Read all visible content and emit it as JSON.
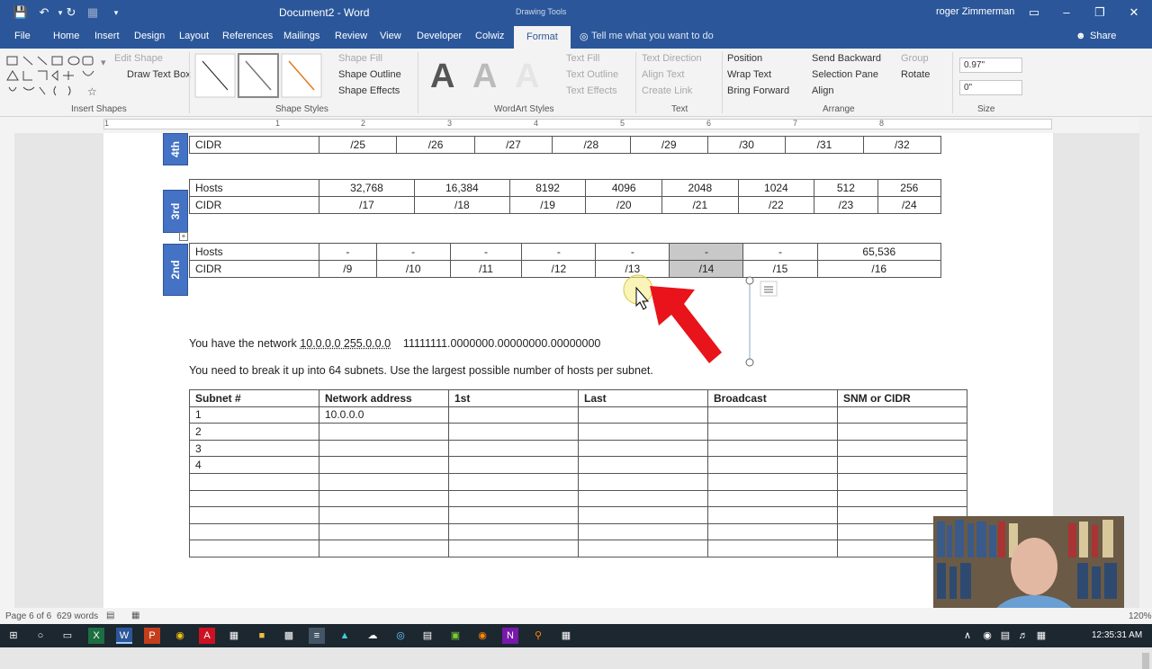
{
  "titlebar": {
    "document_title": "Document2 - Word",
    "context": "Drawing Tools",
    "user": "roger Zimmerman"
  },
  "tabs": {
    "file": "File",
    "home": "Home",
    "insert": "Insert",
    "design": "Design",
    "layout": "Layout",
    "references": "References",
    "mailings": "Mailings",
    "review": "Review",
    "view": "View",
    "developer": "Developer",
    "colwiz": "Colwiz",
    "format": "Format",
    "tell": "Tell me what you want to do",
    "share": "Share"
  },
  "ribbon": {
    "insert_shapes": {
      "edit_shape": "Edit Shape",
      "draw_text_box": "Draw Text Box",
      "group": "Insert Shapes"
    },
    "shape_styles": {
      "fill": "Shape Fill",
      "outline": "Shape Outline",
      "effects": "Shape Effects",
      "group": "Shape Styles"
    },
    "wordart": {
      "text_fill": "Text Fill",
      "text_outline": "Text Outline",
      "text_effects": "Text Effects",
      "group": "WordArt Styles",
      "letter": "A"
    },
    "text": {
      "direction": "Text Direction",
      "align": "Align Text",
      "link": "Create Link",
      "group": "Text"
    },
    "arrange": {
      "position": "Position",
      "wrap": "Wrap Text",
      "forward": "Bring Forward",
      "backward": "Send Backward",
      "selection": "Selection Pane",
      "align": "Align",
      "group_btn": "Group",
      "rotate": "Rotate",
      "group": "Arrange"
    },
    "size": {
      "height": "0.97\"",
      "width": "0\"",
      "group": "Size"
    }
  },
  "ruler": {
    "numbers": [
      "1",
      "1",
      "2",
      "3",
      "4",
      "5",
      "6",
      "7",
      "8"
    ]
  },
  "doc": {
    "table4": {
      "label": "4th",
      "row": {
        "head": "CIDR",
        "cells": [
          "/25",
          "/26",
          "/27",
          "/28",
          "/29",
          "/30",
          "/31",
          "/32"
        ]
      }
    },
    "table3": {
      "label": "3rd",
      "hosts": {
        "head": "Hosts",
        "cells": [
          "32,768",
          "16,384",
          "8192",
          "4096",
          "2048",
          "1024",
          "512",
          "256"
        ]
      },
      "cidr": {
        "head": "CIDR",
        "cells": [
          "/17",
          "/18",
          "/19",
          "/20",
          "/21",
          "/22",
          "/23",
          "/24"
        ]
      }
    },
    "table2": {
      "label": "2nd",
      "hosts": {
        "head": "Hosts",
        "cells": [
          "-",
          "-",
          "-",
          "-",
          "-",
          "-",
          "-",
          "65,536"
        ]
      },
      "cidr": {
        "head": "CIDR",
        "cells": [
          "/9",
          "/10",
          "/11",
          "/12",
          "/13",
          "/14",
          "/15",
          "/16"
        ]
      }
    },
    "para1_pre": "You have the network ",
    "para1_link": "10.0.0.0  255.0.0.0",
    "para1_post": "    11111111.0000000.00000000.00000000",
    "para2": "You need to break it up into 64 subnets. Use the largest possible number of hosts per subnet.",
    "subnet_table": {
      "headers": [
        "Subnet #",
        "Network address",
        "1st",
        "Last",
        "Broadcast",
        "SNM or CIDR"
      ],
      "rows": [
        [
          "1",
          "10.0.0.0",
          "",
          "",
          "",
          ""
        ],
        [
          "2",
          "",
          "",
          "",
          "",
          ""
        ],
        [
          "3",
          "",
          "",
          "",
          "",
          ""
        ],
        [
          "4",
          "",
          "",
          "",
          "",
          ""
        ],
        [
          "",
          "",
          "",
          "",
          "",
          ""
        ],
        [
          "",
          "",
          "",
          "",
          "",
          ""
        ],
        [
          "",
          "",
          "",
          "",
          "",
          ""
        ],
        [
          "",
          "",
          "",
          "",
          "",
          ""
        ],
        [
          "",
          "",
          "",
          "",
          "",
          ""
        ]
      ]
    }
  },
  "status": {
    "page": "Page 6 of 6",
    "words": "629 words",
    "zoom": "120%"
  },
  "taskbar": {
    "time": "12:35:31 AM"
  },
  "colors": {
    "word_blue": "#2b579a",
    "label_blue": "#4472c4",
    "arrow_red": "#e8131b"
  }
}
